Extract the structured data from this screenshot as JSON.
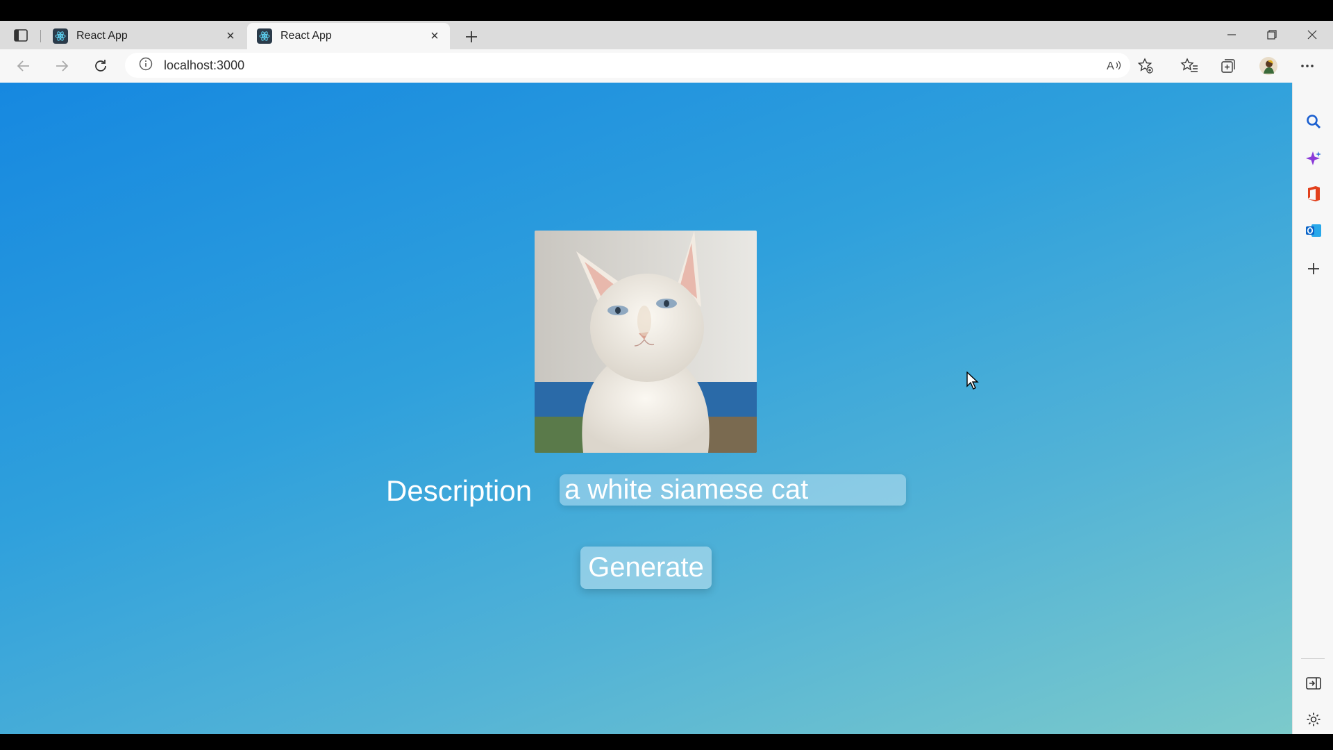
{
  "browser": {
    "tabs": [
      {
        "title": "React App",
        "active": false
      },
      {
        "title": "React App",
        "active": true
      }
    ],
    "url": "localhost:3000",
    "icons": {
      "tab_actions": "tab-actions-icon",
      "new_tab": "plus-icon",
      "back": "back-arrow-icon",
      "forward": "forward-arrow-icon",
      "refresh": "refresh-icon",
      "site_info": "info-icon",
      "read_aloud": "read-aloud-icon",
      "add_favorite": "star-plus-icon",
      "favorites": "favorites-icon",
      "collections": "collections-icon",
      "profile": "avatar",
      "more": "more-icon",
      "minimize": "minimize-icon",
      "restore": "restore-icon",
      "close": "close-icon"
    }
  },
  "sidebar": {
    "items": [
      "search-icon",
      "copilot-icon",
      "office-icon",
      "outlook-icon",
      "add-icon",
      "hide-sidebar-icon",
      "settings-icon"
    ]
  },
  "page": {
    "image_alt": "white siamese cat",
    "description_label": "Description",
    "description_value": "a white siamese cat",
    "generate_label": "Generate"
  },
  "colors": {
    "gradient_start": "#1688e0",
    "gradient_end": "#7ccacb",
    "text": "#ffffff"
  }
}
